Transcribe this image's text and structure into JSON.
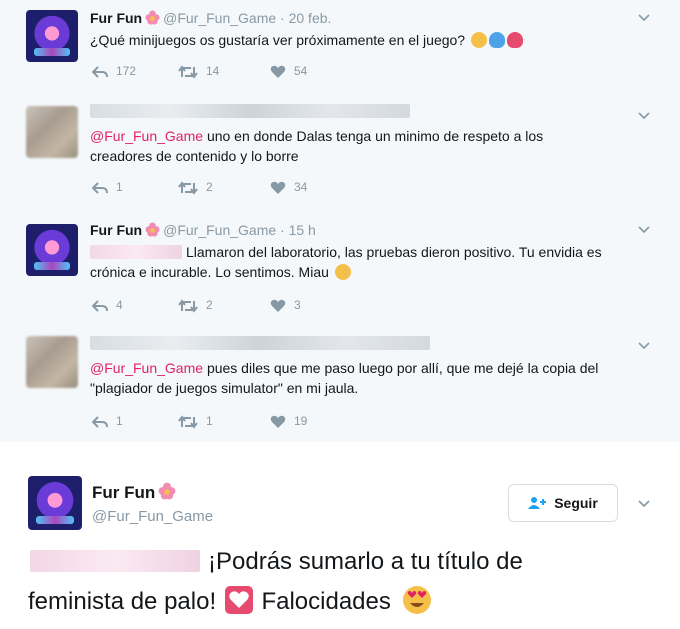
{
  "tweets": [
    {
      "name": "Fur Fun",
      "handle": "@Fur_Fun_Game",
      "time": "· 20 feb.",
      "text": "¿Qué minijuegos os gustaría ver próximamente en el juego?",
      "replies": "172",
      "retweets": "14",
      "likes": "54"
    },
    {
      "mention": "@Fur_Fun_Game",
      "text": "uno en donde Dalas tenga un minimo de respeto a los creadores de contenido y lo borre",
      "replies": "1",
      "retweets": "2",
      "likes": "34"
    },
    {
      "name": "Fur Fun",
      "handle": "@Fur_Fun_Game",
      "time": "· 15 h",
      "text": "Llamaron del laboratorio, las pruebas dieron positivo. Tu envidia es crónica e incurable. Lo sentimos. Miau",
      "replies": "4",
      "retweets": "2",
      "likes": "3"
    },
    {
      "mention": "@Fur_Fun_Game",
      "text": "pues diles que me paso luego por allí, que me dejé la copia del \"plagiador de juegos simulator\" en mi jaula.",
      "replies": "1",
      "retweets": "1",
      "likes": "19"
    }
  ],
  "featured": {
    "name": "Fur Fun",
    "handle": "@Fur_Fun_Game",
    "follow_label": "Seguir",
    "text_line1": "¡Podrás sumarlo a tu título de",
    "text_line2a": "feminista de palo!",
    "text_line2b": "Falocidades"
  },
  "colors": {
    "mention": "#e0245e",
    "meta_gray": "#8899a6",
    "tweet_bg": "#f5f8fa"
  },
  "icons": [
    "flower-emoji-icon",
    "reply-icon",
    "retweet-icon",
    "heart-icon",
    "chevron-down-icon",
    "add-person-icon",
    "heart-eyes-emoji-icon"
  ]
}
